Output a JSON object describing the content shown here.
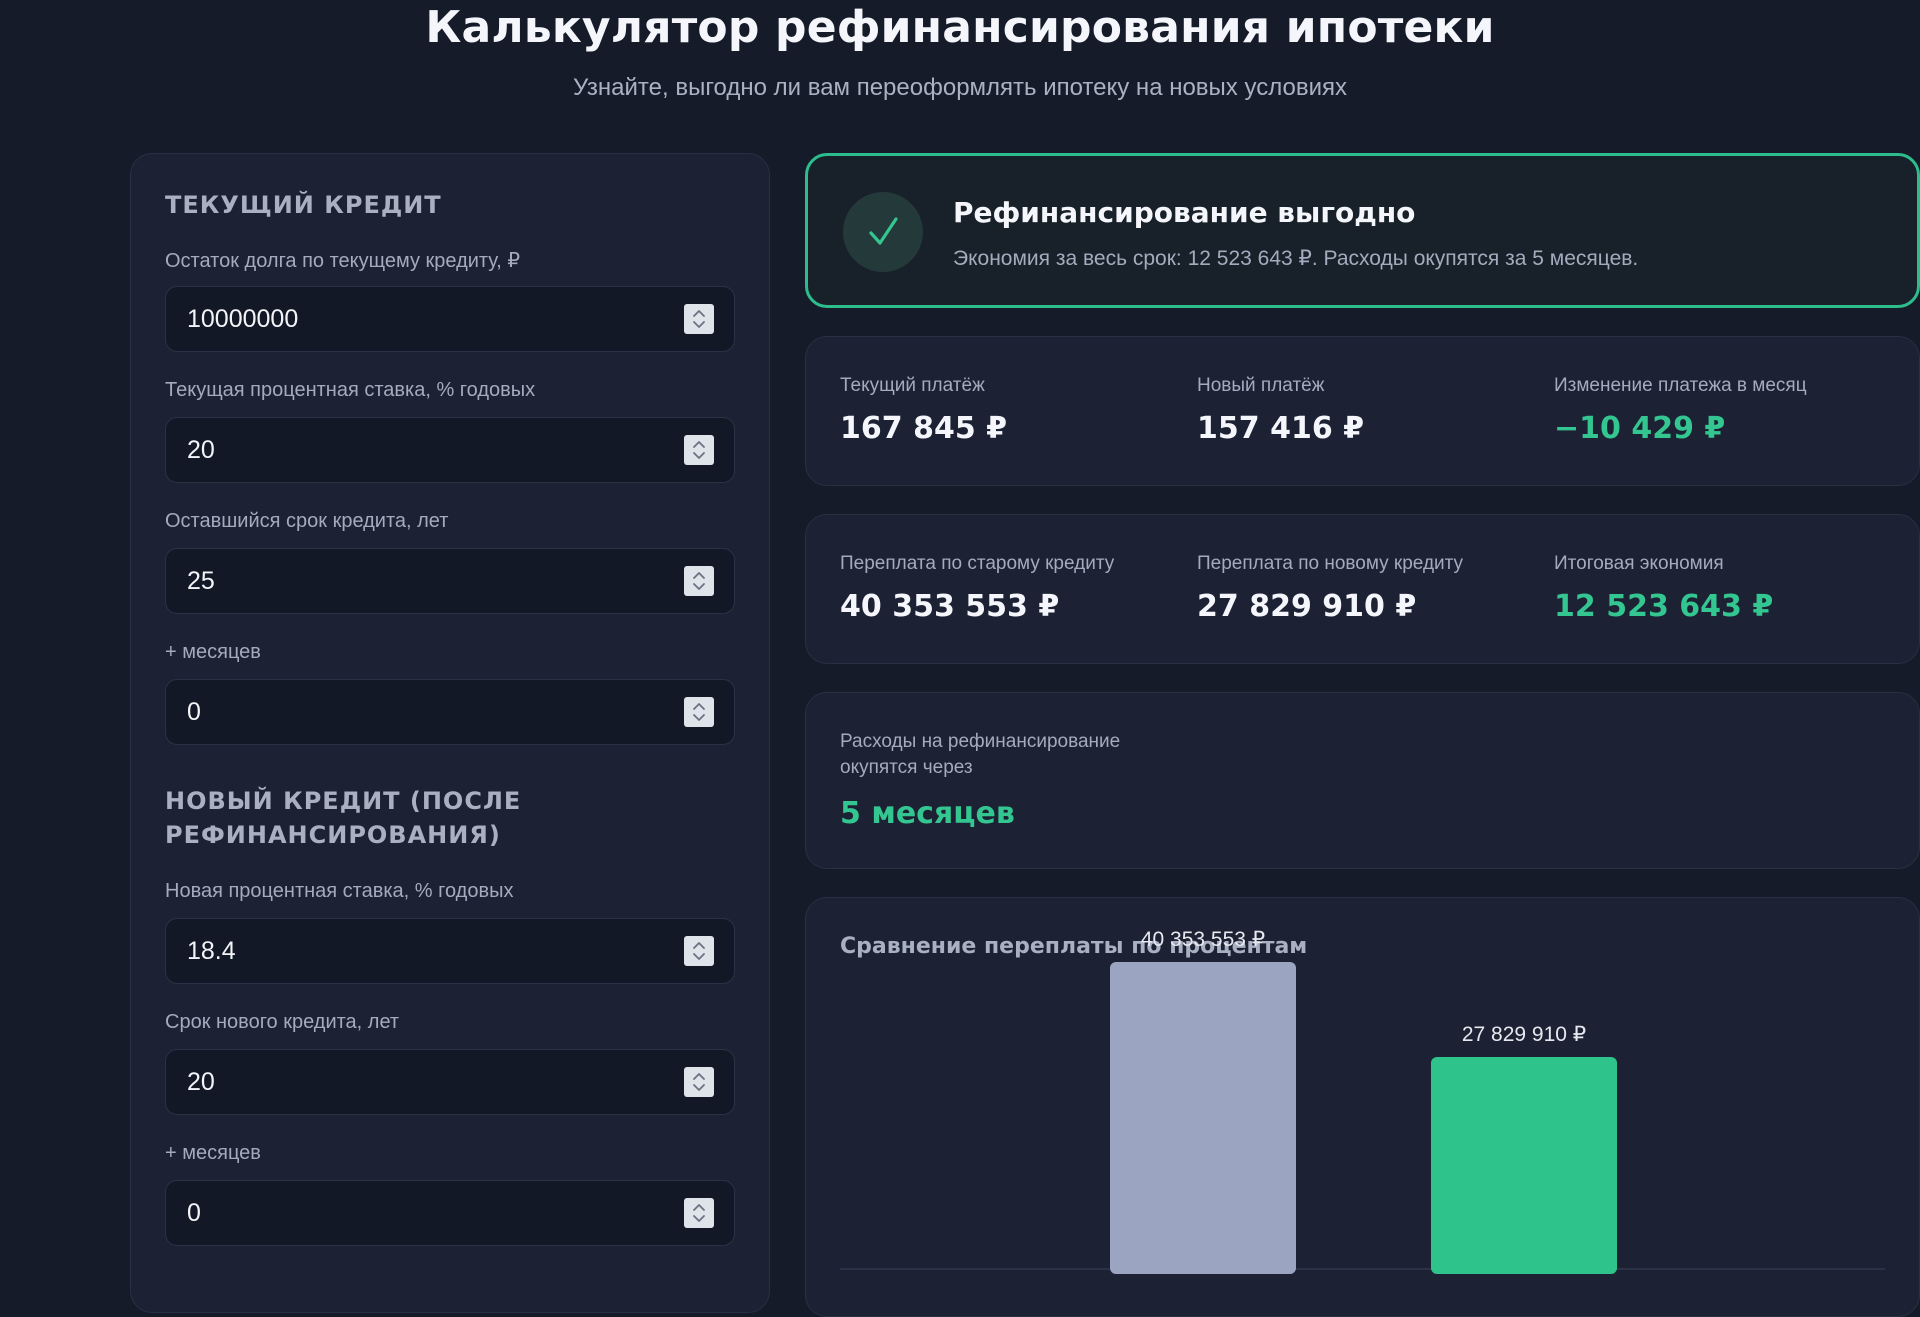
{
  "header": {
    "title": "Калькулятор рефинансирования ипотеки",
    "subtitle": "Узнайте, выгодно ли вам переоформлять ипотеку на новых условиях"
  },
  "current_loan": {
    "section_title": "ТЕКУЩИЙ КРЕДИТ",
    "fields": [
      {
        "label": "Остаток долга по текущему кредиту, ₽",
        "value": "10000000"
      },
      {
        "label": "Текущая процентная ставка, % годовых",
        "value": "20"
      },
      {
        "label": "Оставшийся срок кредита, лет",
        "value": "25"
      },
      {
        "label": "+ месяцев",
        "value": "0"
      }
    ]
  },
  "new_loan": {
    "section_title_line1": "НОВЫЙ КРЕДИТ (ПОСЛЕ",
    "section_title_line2": "РЕФИНАНСИРОВАНИЯ)",
    "fields": [
      {
        "label": "Новая процентная ставка, % годовых",
        "value": "18.4"
      },
      {
        "label": "Срок нового кредита, лет",
        "value": "20"
      },
      {
        "label": "+ месяцев",
        "value": "0"
      }
    ]
  },
  "status": {
    "icon": "check-icon",
    "title": "Рефинансирование выгодно",
    "text": "Экономия за весь срок: 12 523 643 ₽. Расходы окупятся за 5 месяцев."
  },
  "payments": {
    "current_label": "Текущий платёж",
    "current_value": "167 845 ₽",
    "new_label": "Новый платёж",
    "new_value": "157 416 ₽",
    "change_label": "Изменение платежа в месяц",
    "change_value": "−10 429 ₽"
  },
  "overpayment": {
    "old_label": "Переплата по старому кредиту",
    "old_value": "40 353 553 ₽",
    "new_label": "Переплата по новому кредиту",
    "new_value": "27 829 910 ₽",
    "saving_label": "Итоговая экономия",
    "saving_value": "12 523 643 ₽"
  },
  "payback": {
    "label_line1": "Расходы на рефинансирование",
    "label_line2": "окупятся через",
    "value": "5 месяцев"
  },
  "colors": {
    "accent_green": "#34c690",
    "bar_old": "#9ba5c2",
    "bar_new": "#2fc38c",
    "background": "#161b2a"
  },
  "chart_data": {
    "type": "bar",
    "title": "Сравнение переплаты по процентам",
    "categories": [
      "",
      ""
    ],
    "values": [
      40353553,
      27829910
    ],
    "data_labels": [
      "40 353 553 ₽",
      "27 829 910 ₽"
    ],
    "colors": [
      "#9ba5c2",
      "#2fc38c"
    ],
    "ylim": [
      0,
      43000000
    ],
    "grid": false
  }
}
